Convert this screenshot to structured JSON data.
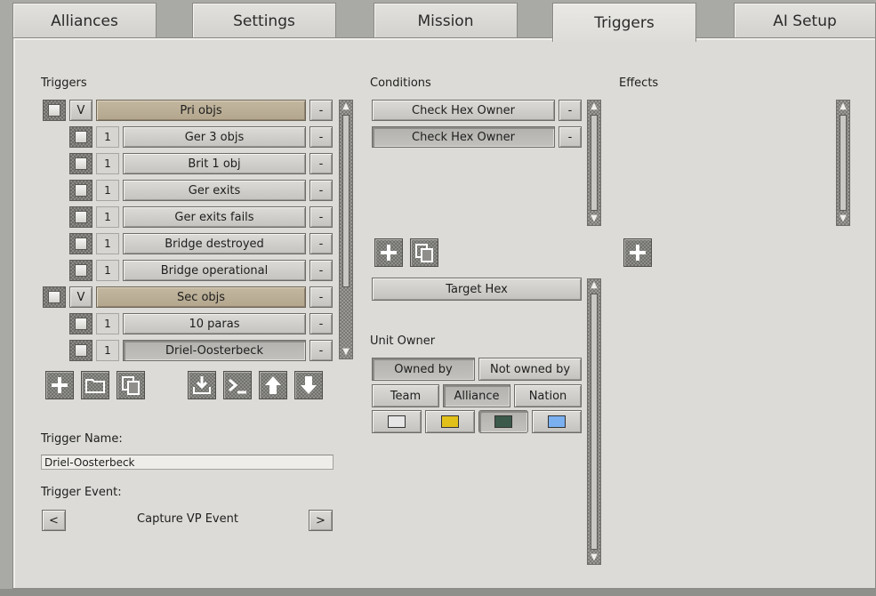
{
  "tabs": [
    {
      "label": "Alliances",
      "active": false
    },
    {
      "label": "Settings",
      "active": false
    },
    {
      "label": "Mission",
      "active": false
    },
    {
      "label": "Triggers",
      "active": true
    },
    {
      "label": "AI Setup",
      "active": false
    }
  ],
  "triggers": {
    "heading": "Triggers",
    "remove_label": "-",
    "items": [
      {
        "type": "group",
        "toggle": "V",
        "label": "Pri objs"
      },
      {
        "type": "item",
        "count": "1",
        "label": "Ger 3 objs"
      },
      {
        "type": "item",
        "count": "1",
        "label": "Brit 1 obj"
      },
      {
        "type": "item",
        "count": "1",
        "label": "Ger exits"
      },
      {
        "type": "item",
        "count": "1",
        "label": "Ger exits  fails"
      },
      {
        "type": "item",
        "count": "1",
        "label": "Bridge destroyed"
      },
      {
        "type": "item",
        "count": "1",
        "label": "Bridge operational"
      },
      {
        "type": "group",
        "toggle": "V",
        "label": "Sec objs"
      },
      {
        "type": "item",
        "count": "1",
        "label": "10 paras"
      },
      {
        "type": "item",
        "count": "1",
        "label": "Driel-Oosterbeck",
        "selected": true
      }
    ],
    "toolbar_icons": [
      "add-icon",
      "folder-icon",
      "copy-icon",
      "import-icon",
      "console-icon",
      "move-up-icon",
      "move-down-icon"
    ]
  },
  "trigger_name": {
    "label": "Trigger Name:",
    "value": "Driel-Oosterbeck"
  },
  "trigger_event": {
    "label": "Trigger Event:",
    "value": "Capture VP Event",
    "prev": "<",
    "next": ">"
  },
  "conditions": {
    "heading": "Conditions",
    "remove_label": "-",
    "items": [
      {
        "label": "Check Hex Owner"
      },
      {
        "label": "Check Hex Owner",
        "selected": true
      }
    ]
  },
  "condition_detail": {
    "target_hex_label": "Target Hex",
    "unit_owner_label": "Unit Owner",
    "owned_by": "Owned by",
    "not_owned_by": "Not owned by",
    "team": "Team",
    "alliance": "Alliance",
    "nation": "Nation",
    "swatches": [
      "#e6e6e6",
      "#e2c01a",
      "#3b5a4c",
      "#7ab0f0"
    ],
    "selected_swatch": 2
  },
  "effects": {
    "heading": "Effects"
  }
}
